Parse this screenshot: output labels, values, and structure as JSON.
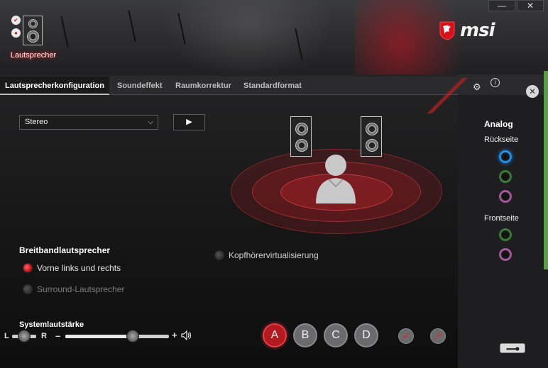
{
  "window": {
    "minimize_label": "—",
    "close_label": "✕"
  },
  "brand": {
    "logo_text": "msi"
  },
  "device": {
    "label": "Lautsprecher"
  },
  "tabs": [
    {
      "label": "Lautsprecherkonfiguration",
      "active": true
    },
    {
      "label": "Soundeffekt",
      "active": false
    },
    {
      "label": "Raumkorrektur",
      "active": false
    },
    {
      "label": "Standardformat",
      "active": false
    }
  ],
  "config": {
    "selected": "Stereo",
    "play_label": "▶"
  },
  "broadband": {
    "title": "Breitbandlautsprecher",
    "options": [
      {
        "label": "Vorne links und rechts",
        "checked": true
      },
      {
        "label": "Surround-Lautsprecher",
        "checked": false
      }
    ]
  },
  "headphone_virtualization": {
    "label": "Kopfhörervirtualisierung",
    "checked": false
  },
  "volume": {
    "title": "Systemlautstärke",
    "left_label": "L",
    "right_label": "R",
    "minus_label": "–",
    "plus_label": "+",
    "level_fraction": 0.65,
    "balance_fraction": 0.5
  },
  "presets": [
    {
      "label": "A",
      "active": true
    },
    {
      "label": "B",
      "active": false
    },
    {
      "label": "C",
      "active": false
    },
    {
      "label": "D",
      "active": false
    }
  ],
  "side_panel": {
    "title": "Analog",
    "rear_label": "Rückseite",
    "front_label": "Frontseite",
    "rear_jacks": [
      {
        "color": "#1e8fe8",
        "active": true
      },
      {
        "color": "#3b7a3b",
        "active": false
      },
      {
        "color": "#a2589a",
        "active": false
      }
    ],
    "front_jacks": [
      {
        "color": "#3b7a3b",
        "active": false
      },
      {
        "color": "#a2589a",
        "active": false
      }
    ]
  },
  "colors": {
    "accent_red": "#d0141a",
    "active_jack": "#1e8fe8"
  }
}
